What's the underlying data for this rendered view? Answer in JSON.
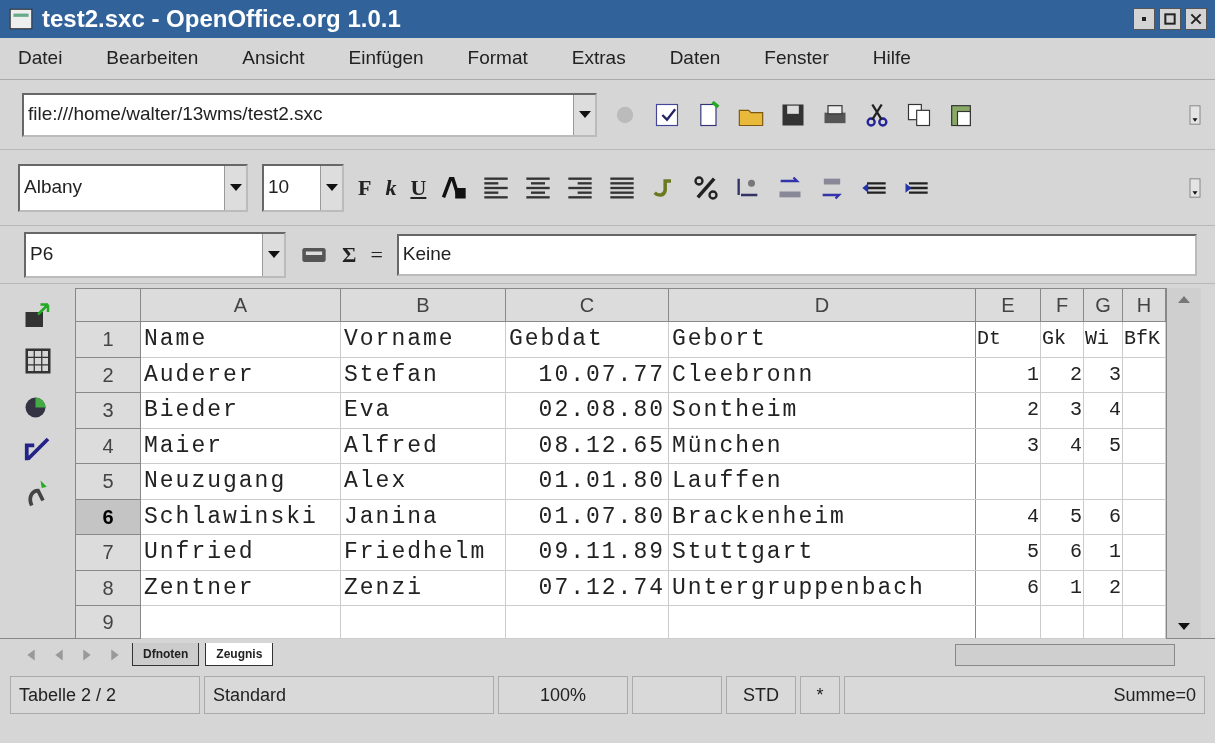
{
  "window": {
    "title": "test2.sxc - OpenOffice.org 1.0.1"
  },
  "menu": [
    "Datei",
    "Bearbeiten",
    "Ansicht",
    "Einfügen",
    "Format",
    "Extras",
    "Daten",
    "Fenster",
    "Hilfe"
  ],
  "url_field": {
    "value": "file:///home/walter/13wms/test2.sxc"
  },
  "font_name": {
    "value": "Albany"
  },
  "font_size": {
    "value": "10"
  },
  "format_buttons": [
    "F",
    "k",
    "U"
  ],
  "formula_bar": {
    "cell_ref": "P6",
    "sum_symbol": "Σ",
    "equals_symbol": "=",
    "content": "Keine"
  },
  "grid": {
    "columns": [
      "A",
      "B",
      "C",
      "D",
      "E",
      "F",
      "G",
      "H"
    ],
    "rows": [
      {
        "number": "1",
        "selected": false,
        "cells": [
          "Name",
          "Vorname",
          "Gebdat",
          "Gebort",
          "Dt",
          "Gk",
          "Wi",
          "BfK"
        ]
      },
      {
        "number": "2",
        "selected": false,
        "cells": [
          "Auderer",
          "Stefan",
          "10.07.77",
          "Cleebronn",
          "1",
          "2",
          "3",
          ""
        ]
      },
      {
        "number": "3",
        "selected": false,
        "cells": [
          "Bieder",
          "Eva",
          "02.08.80",
          "Sontheim",
          "2",
          "3",
          "4",
          ""
        ]
      },
      {
        "number": "4",
        "selected": false,
        "cells": [
          "Maier",
          "Alfred",
          "08.12.65",
          "München",
          "3",
          "4",
          "5",
          ""
        ]
      },
      {
        "number": "5",
        "selected": false,
        "cells": [
          "Neuzugang",
          "Alex",
          "01.01.80",
          "Lauffen",
          "",
          "",
          "",
          ""
        ]
      },
      {
        "number": "6",
        "selected": true,
        "cells": [
          "Schlawinski",
          "Janina",
          "01.07.80",
          "Brackenheim",
          "4",
          "5",
          "6",
          ""
        ]
      },
      {
        "number": "7",
        "selected": false,
        "cells": [
          "Unfried",
          "Friedhelm",
          "09.11.89",
          "Stuttgart",
          "5",
          "6",
          "1",
          ""
        ]
      },
      {
        "number": "8",
        "selected": false,
        "cells": [
          "Zentner",
          "Zenzi",
          "07.12.74",
          "Untergruppenbach",
          "6",
          "1",
          "2",
          ""
        ]
      },
      {
        "number": "9",
        "selected": false,
        "cells": [
          "",
          "",
          "",
          "",
          "",
          "",
          "",
          ""
        ]
      }
    ]
  },
  "sheet_tabs": [
    {
      "label": "Dfnoten",
      "selected": false
    },
    {
      "label": "Zeugnis",
      "selected": true
    }
  ],
  "status_bar": [
    {
      "kind": "text",
      "text": "Tabelle 2 / 2"
    },
    {
      "kind": "text",
      "text": "Standard"
    },
    {
      "kind": "text",
      "text": "100%"
    },
    {
      "kind": "blank"
    },
    {
      "kind": "text",
      "text": "STD"
    },
    {
      "kind": "text",
      "text": "*"
    },
    {
      "kind": "text",
      "text": "Summe=0"
    }
  ]
}
